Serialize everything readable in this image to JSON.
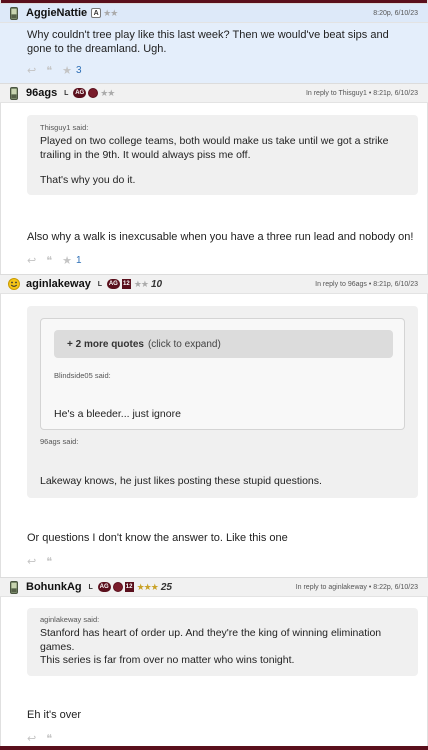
{
  "posts": [
    {
      "username": "AggieNattie",
      "badges": [
        "A"
      ],
      "stars": "★★",
      "meta": "8:20p, 6/10/23",
      "text": "Why couldn't tree play like this last week? Then we would've beat sips and gone to the dreamland. Ugh.",
      "star_count": "3"
    },
    {
      "username": "96ags",
      "badges": [
        "L",
        "AG"
      ],
      "stars": "★★",
      "meta": "In reply to Thisguy1 • 8:21p, 6/10/23",
      "quote_author": "Thisguy1 said:",
      "quote_line1": "Played on two college teams, both would make us take until we got a strike trailing in the 9th. It would always piss me off.",
      "quote_line2": "That's why you do it.",
      "text": "Also why a walk is inexcusable when you have a three run lead and nobody on!",
      "star_count": "1"
    },
    {
      "username": "aginlakeway",
      "badges": [
        "L",
        "AG",
        "12"
      ],
      "stars": "★★",
      "rank": "10",
      "meta": "In reply to 96ags • 8:21p, 6/10/23",
      "expand_bold": "+ 2 more quotes",
      "expand_rest": "(click to expand)",
      "inner_author": "Blindside05 said:",
      "inner_text": "He's a bleeder... just ignore",
      "quote_author": "96ags said:",
      "quote_text": "Lakeway knows, he just likes posting these stupid questions.",
      "text": "Or questions I don't know the answer to. Like this one"
    },
    {
      "username": "BohunkAg",
      "badges": [
        "L",
        "AG",
        "12"
      ],
      "stars": "★★★",
      "rank": "25",
      "meta": "In reply to aginlakeway • 8:22p, 6/10/23",
      "quote_author": "aginlakeway said:",
      "quote_line1": "Stanford has heart of order up. And they're the king of winning elimination games.",
      "quote_line2": "This series is far from over no matter who wins tonight.",
      "text": "Eh it's over"
    }
  ],
  "icons": {
    "reply": "reply-icon",
    "quote": "quote-icon",
    "star": "star-icon",
    "phone_avatar": "phone-icon",
    "smiley_avatar": "smiley-icon"
  },
  "colors": {
    "maroon": "#5a0f1c",
    "highlight": "#dde9f9",
    "link_blue": "#2d6fb6",
    "gold": "#c9a227"
  }
}
